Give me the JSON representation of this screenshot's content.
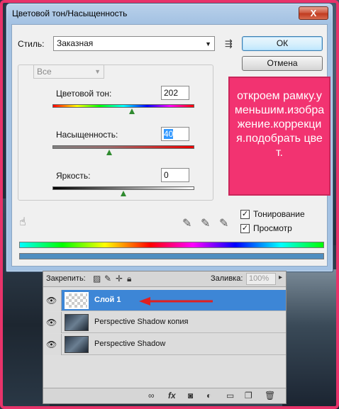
{
  "dialog": {
    "title": "Цветовой тон/Насыщенность",
    "close_glyph": "X",
    "style_label": "Стиль:",
    "style_value": "Заказная",
    "ok_label": "ОК",
    "cancel_label": "Отмена",
    "edit_value": "Все",
    "hue_label": "Цветовой тон:",
    "hue_value": "202",
    "saturation_label": "Насыщенность:",
    "saturation_value": "40",
    "lightness_label": "Яркость:",
    "lightness_value": "0",
    "colorize_label": "Тонирование",
    "colorize_checked": true,
    "preview_label": "Просмотр",
    "preview_checked": true,
    "icons": {
      "menu": "list-options-icon",
      "hand": "targeted-adjustment-icon",
      "eyedropper": "eyedropper-icon",
      "eyedropper_add": "eyedropper-plus-icon",
      "eyedropper_sub": "eyedropper-minus-icon"
    },
    "result_color": "#4f8ec0"
  },
  "annotation": {
    "text": "откроем рамку.уменьшим.изображение.коррекция.подобрать цвет.",
    "background": "#f23371"
  },
  "layers_panel": {
    "lock_label": "Закрепить:",
    "fill_label": "Заливка:",
    "fill_value": "100%",
    "layers": [
      {
        "name": "Слой 1",
        "active": true,
        "thumbnail": "transparent"
      },
      {
        "name": "Perspective Shadow копия",
        "active": false,
        "thumbnail": "photo"
      },
      {
        "name": "Perspective Shadow",
        "active": false,
        "thumbnail": "photo"
      }
    ],
    "bottom_icons": [
      "link-icon",
      "fx-icon",
      "mask-icon",
      "adjustment-icon",
      "group-folder-icon",
      "new-layer-icon",
      "trash-icon"
    ]
  },
  "colors": {
    "frame": "#e8336a",
    "arrow": "#e02020",
    "active_layer": "#3d86d6"
  }
}
